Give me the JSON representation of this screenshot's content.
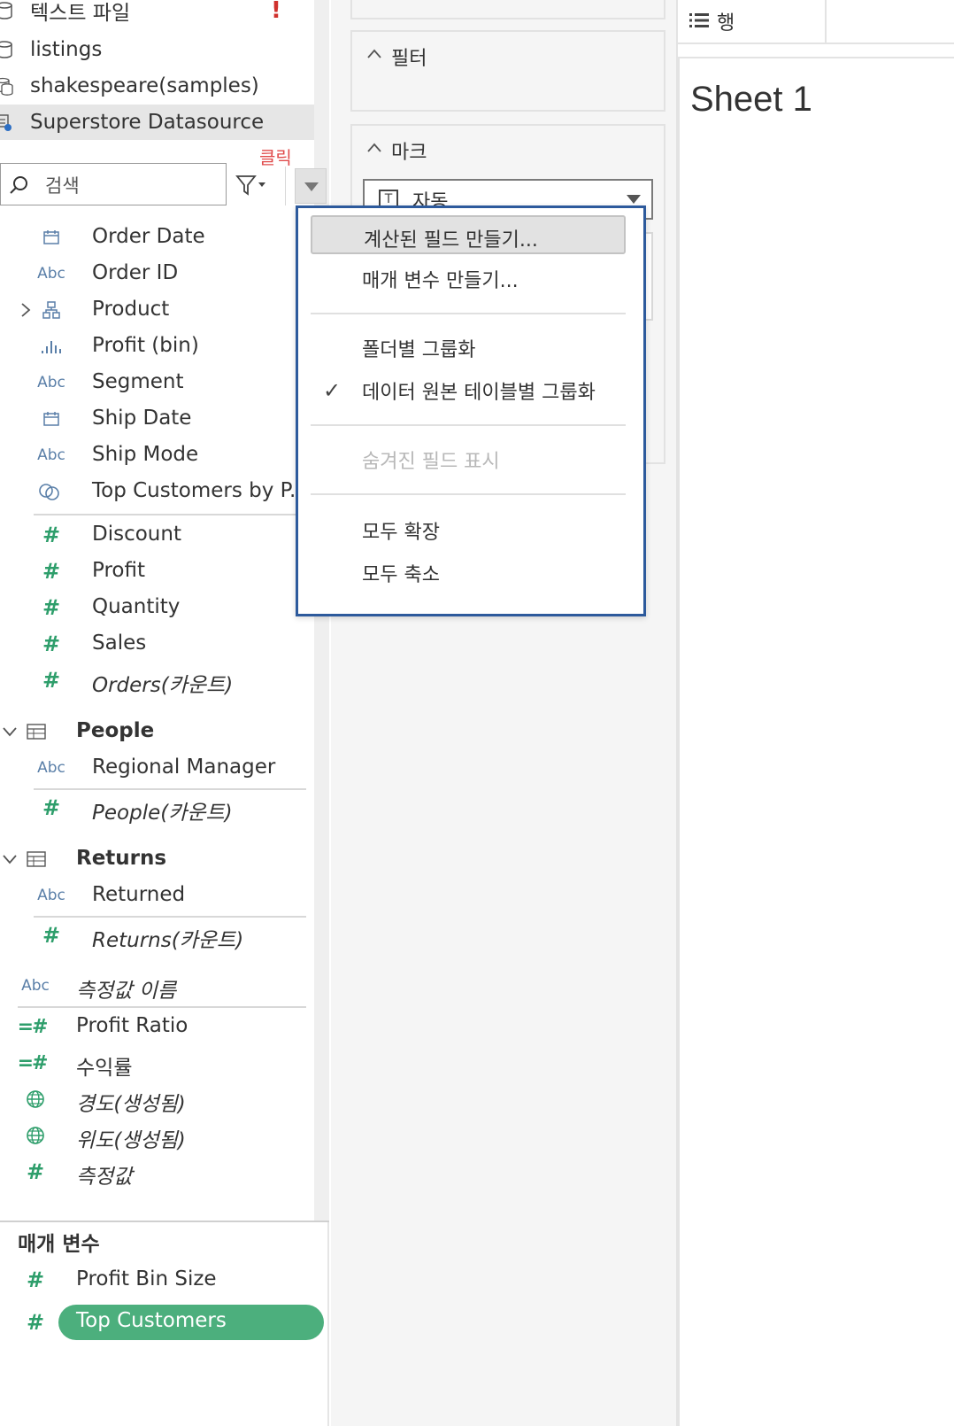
{
  "datasources": [
    {
      "label": "텍스트 파일",
      "icon": "cylinder-icon",
      "warning": "!"
    },
    {
      "label": "listings",
      "icon": "cylinder-icon"
    },
    {
      "label": "shakespeare(samples)",
      "icon": "multi-cylinder-icon"
    },
    {
      "label": "Superstore Datasource",
      "icon": "datasource-extract-icon",
      "selected": true
    }
  ],
  "annotation": {
    "click_note": "클릭"
  },
  "search": {
    "label": "검색"
  },
  "orders_fields": [
    {
      "label": "Order Date",
      "type": "date"
    },
    {
      "label": "Order ID",
      "type": "Abc"
    },
    {
      "label": "Product",
      "type": "hierarchy"
    },
    {
      "label": "Profit (bin)",
      "type": "bin"
    },
    {
      "label": "Segment",
      "type": "Abc"
    },
    {
      "label": "Ship Date",
      "type": "date"
    },
    {
      "label": "Ship Mode",
      "type": "Abc"
    },
    {
      "label": "Top Customers by P..",
      "type": "set"
    }
  ],
  "orders_measures": [
    {
      "label": "Discount"
    },
    {
      "label": "Profit"
    },
    {
      "label": "Quantity"
    },
    {
      "label": "Sales"
    },
    {
      "label": "Orders(카운트)",
      "italic": true
    }
  ],
  "people": {
    "title": "People",
    "dimension": "Regional Manager",
    "count": "People(카운트)"
  },
  "returns": {
    "title": "Returns",
    "dimension": "Returned",
    "count": "Returns(카운트)"
  },
  "measure_names": "측정값 이름",
  "extra_measures": [
    {
      "label": "Profit Ratio",
      "type": "calc"
    },
    {
      "label": "수익률",
      "type": "calc"
    },
    {
      "label": "경도(생성됨)",
      "type": "geo"
    },
    {
      "label": "위도(생성됨)",
      "type": "geo"
    },
    {
      "label": "측정값",
      "type": "number"
    }
  ],
  "abc_label": "Abc",
  "parameters": {
    "title": "매개 변수",
    "items": [
      {
        "label": "Profit Bin Size"
      },
      {
        "label": "Top Customers",
        "selected": true
      }
    ]
  },
  "cards": {
    "filter": "필터",
    "marks": "마크",
    "marks_type": "자동",
    "marks_type_icon": "T"
  },
  "shelves": {
    "rows": "행"
  },
  "sheet": {
    "title": "Sheet 1"
  },
  "context_menu": {
    "items": [
      {
        "label": "계산된 필드 만들기...",
        "state": "highlighted"
      },
      {
        "label": "매개 변수 만들기..."
      },
      {
        "label": "폴더별 그룹화"
      },
      {
        "label": "데이터 원본 테이블별 그룹화",
        "checked": true,
        "check": "✓"
      },
      {
        "label": "숨겨진 필드 표시",
        "state": "disabled"
      },
      {
        "label": "모두 확장"
      },
      {
        "label": "모두 축소"
      }
    ]
  },
  "colors": {
    "accent_green": "#4caf7d",
    "measure_green": "#2e9e6b",
    "dimension_blue": "#5a7fa8",
    "menu_border": "#2d5a9c",
    "warning_red": "#d0312d",
    "annotation_red": "#e04b4b"
  }
}
